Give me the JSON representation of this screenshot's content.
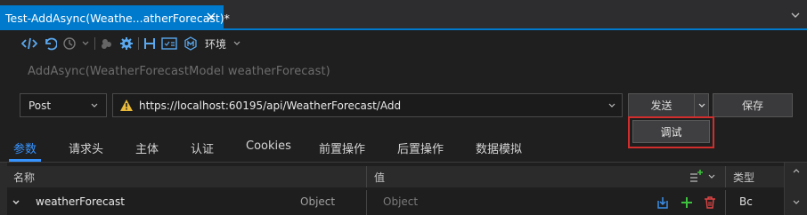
{
  "tab": {
    "title": "Test-AddAsync(Weathe...atherForecast)*"
  },
  "toolbar": {
    "env_label": "环境"
  },
  "signature": "AddAsync(WeatherForecastModel weatherForecast)",
  "request": {
    "method": "Post",
    "url": "https://localhost:60195/api/WeatherForecast/Add",
    "send_label": "发送",
    "save_label": "保存",
    "debug_label": "调试"
  },
  "section_tabs": [
    "参数",
    "请求头",
    "主体",
    "认证",
    "Cookies",
    "前置操作",
    "后置操作",
    "数据模拟"
  ],
  "table": {
    "headers": {
      "name": "名称",
      "value": "值",
      "type": "类型"
    },
    "rows": [
      {
        "name": "weatherForecast",
        "type_hint": "Object",
        "value_placeholder": "Object",
        "type": "Bc"
      }
    ]
  },
  "colors": {
    "accent": "#007acc",
    "active_tab": "#3794ff",
    "highlight": "#d12d2d"
  }
}
